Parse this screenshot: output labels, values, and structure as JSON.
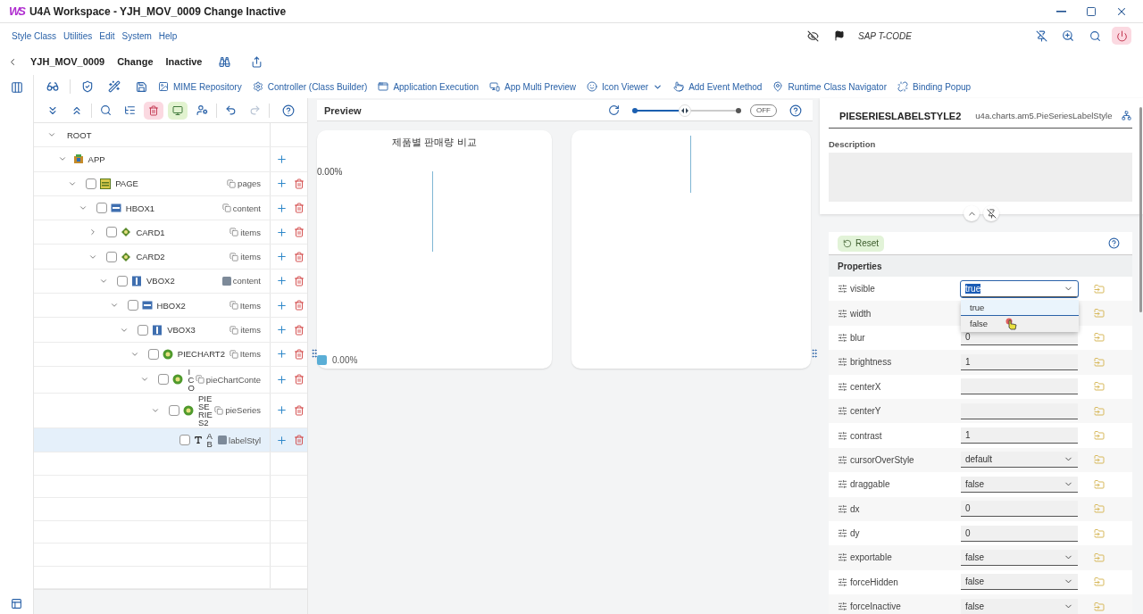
{
  "window": {
    "logo": "WS",
    "title": "U4A Workspace - YJH_MOV_0009 Change Inactive"
  },
  "menu": [
    "Style Class",
    "Utilities",
    "Edit",
    "System",
    "Help"
  ],
  "tcode": {
    "placeholder": "SAP T-CODE"
  },
  "header": {
    "app_id": "YJH_MOV_0009",
    "mode": "Change",
    "status": "Inactive"
  },
  "toolbar": [
    {
      "label": "MIME Repository",
      "has_menu": false
    },
    {
      "label": "Controller (Class Builder)",
      "has_menu": false
    },
    {
      "label": "Application Execution",
      "has_menu": false
    },
    {
      "label": "App Multi Preview",
      "has_menu": false
    },
    {
      "label": "Icon Viewer",
      "has_menu": true
    },
    {
      "label": "Add Event Method",
      "has_menu": false
    },
    {
      "label": "Runtime Class Navigator",
      "has_menu": false
    },
    {
      "label": "Binding Popup",
      "has_menu": false
    }
  ],
  "tree": [
    {
      "name": "ROOT",
      "expanded": true,
      "selected": false,
      "addable": false,
      "deletable": false,
      "children": [
        {
          "name": "APP",
          "kind": "app",
          "expanded": true,
          "selected": false,
          "addable": true,
          "deletable": false,
          "children": [
            {
              "name": "PAGE",
              "kind": "page",
              "expanded": true,
              "checked": false,
              "selected": false,
              "aggregation": {
                "text": "pages",
                "kind": "multiple"
              },
              "addable": true,
              "deletable": true,
              "children": [
                {
                  "name": "HBOX1",
                  "kind": "hbox",
                  "expanded": true,
                  "checked": false,
                  "selected": false,
                  "aggregation": {
                    "text": "content",
                    "kind": "multiple"
                  },
                  "addable": true,
                  "deletable": true,
                  "children": [
                    {
                      "name": "CARD1",
                      "kind": "card",
                      "expanded": false,
                      "checked": false,
                      "selected": false,
                      "aggregation": {
                        "text": "items",
                        "kind": "multiple"
                      },
                      "addable": true,
                      "deletable": true
                    },
                    {
                      "name": "CARD2",
                      "kind": "card",
                      "expanded": true,
                      "checked": false,
                      "selected": false,
                      "aggregation": {
                        "text": "items",
                        "kind": "multiple"
                      },
                      "addable": true,
                      "deletable": true,
                      "children": [
                        {
                          "name": "VBOX2",
                          "kind": "vbox",
                          "expanded": true,
                          "checked": false,
                          "selected": false,
                          "aggregation": {
                            "text": "content",
                            "kind": "single"
                          },
                          "addable": true,
                          "deletable": true,
                          "children": [
                            {
                              "name": "HBOX2",
                              "kind": "hbox",
                              "expanded": true,
                              "checked": false,
                              "selected": false,
                              "aggregation": {
                                "text": "Items",
                                "kind": "multiple"
                              },
                              "addable": true,
                              "deletable": true,
                              "children": [
                                {
                                  "name": "VBOX3",
                                  "kind": "vbox",
                                  "expanded": true,
                                  "checked": false,
                                  "selected": false,
                                  "aggregation": {
                                    "text": "items",
                                    "kind": "multiple"
                                  },
                                  "addable": true,
                                  "deletable": true,
                                  "children": [
                                    {
                                      "name": "PIECHART2",
                                      "kind": "chart",
                                      "expanded": true,
                                      "checked": false,
                                      "selected": false,
                                      "aggregation": {
                                        "text": "Items",
                                        "kind": "multiple"
                                      },
                                      "addable": true,
                                      "deletable": true,
                                      "children": [
                                        {
                                          "name": "ICO",
                                          "kind": "chart",
                                          "expanded": true,
                                          "checked": false,
                                          "selected": false,
                                          "aggregation": {
                                            "text": "pieChartConte",
                                            "kind": "multiple"
                                          },
                                          "addable": true,
                                          "deletable": true,
                                          "children": [
                                            {
                                              "name": "PIESERIES2",
                                              "kind": "chart",
                                              "expanded": true,
                                              "checked": false,
                                              "selected": false,
                                              "aggregation": {
                                                "text": "pieSeries",
                                                "kind": "multiple"
                                              },
                                              "addable": true,
                                              "deletable": true,
                                              "children": [
                                                {
                                                  "name": "AB",
                                                  "kind": "text",
                                                  "checked": false,
                                                  "selected": true,
                                                  "aggregation": {
                                                    "text": "labelStyl",
                                                    "kind": "single"
                                                  },
                                                  "addable": true,
                                                  "deletable": true
                                                }
                                              ]
                                            }
                                          ]
                                        }
                                      ]
                                    }
                                  ]
                                }
                              ]
                            }
                          ]
                        }
                      ]
                    }
                  ]
                }
              ]
            }
          ]
        }
      ]
    }
  ],
  "preview": {
    "title": "Preview",
    "zoom": {
      "level": 0.48
    },
    "live_toggle": {
      "label": "OFF",
      "on": false
    },
    "cards": [
      {
        "kind": "chart",
        "title": "제품별 판매량 비교",
        "axis_label": "0.00%",
        "legend": [
          "0.00%"
        ]
      },
      {
        "kind": "line"
      }
    ]
  },
  "properties": {
    "element": {
      "name": "PIESERIESLABELSTYLE2",
      "class": "u4a.charts.am5.PieSeriesLabelStyle"
    },
    "description": {
      "label": "Description"
    },
    "reset": "Reset",
    "section": "Properties",
    "rows": [
      {
        "name": "visible",
        "kind": "select",
        "value": "true",
        "text_selected": true
      },
      {
        "name": "width"
      },
      {
        "name": "blur",
        "kind": "input",
        "value": "0"
      },
      {
        "name": "brightness",
        "kind": "input",
        "value": "1"
      },
      {
        "name": "centerX",
        "kind": "input"
      },
      {
        "name": "centerY",
        "kind": "input"
      },
      {
        "name": "contrast",
        "kind": "input",
        "value": "1"
      },
      {
        "name": "cursorOverStyle",
        "kind": "select",
        "value": "default"
      },
      {
        "name": "draggable",
        "kind": "select",
        "value": "false"
      },
      {
        "name": "dx",
        "kind": "input",
        "value": "0"
      },
      {
        "name": "dy",
        "kind": "input",
        "value": "0"
      },
      {
        "name": "exportable",
        "kind": "select",
        "value": "false"
      },
      {
        "name": "forceHidden",
        "kind": "select",
        "value": "false"
      },
      {
        "name": "forceInactive",
        "kind": "select",
        "value": "false"
      }
    ],
    "dropdown": {
      "options": [
        {
          "label": "true",
          "selected": true,
          "hovered": false
        },
        {
          "label": "false",
          "selected": false,
          "hovered": true
        }
      ]
    }
  }
}
